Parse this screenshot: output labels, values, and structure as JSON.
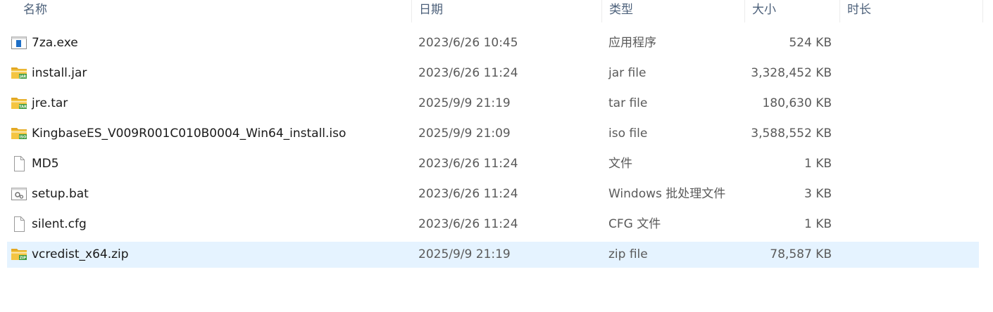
{
  "columns": {
    "name": "名称",
    "date": "日期",
    "type": "类型",
    "size": "大小",
    "duration": "时长"
  },
  "files": [
    {
      "name": "7za.exe",
      "date": "2023/6/26 10:45",
      "type": "应用程序",
      "size": "524 KB",
      "icon": "exe-app-icon"
    },
    {
      "name": "install.jar",
      "date": "2023/6/26 11:24",
      "type": "jar file",
      "size": "3,328,452 KB",
      "icon": "jar-archive-icon",
      "icon_tag": "JAR"
    },
    {
      "name": "jre.tar",
      "date": "2025/9/9 21:19",
      "type": "tar file",
      "size": "180,630 KB",
      "icon": "tar-archive-icon",
      "icon_tag": "TAR"
    },
    {
      "name": "KingbaseES_V009R001C010B0004_Win64_install.iso",
      "date": "2025/9/9 21:09",
      "type": "iso file",
      "size": "3,588,552 KB",
      "icon": "iso-archive-icon",
      "icon_tag": "ISO"
    },
    {
      "name": "MD5",
      "date": "2023/6/26 11:24",
      "type": "文件",
      "size": "1 KB",
      "icon": "blank-file-icon"
    },
    {
      "name": "setup.bat",
      "date": "2023/6/26 11:24",
      "type": "Windows 批处理文件",
      "size": "3 KB",
      "icon": "batch-file-icon"
    },
    {
      "name": "silent.cfg",
      "date": "2023/6/26 11:24",
      "type": "CFG 文件",
      "size": "1 KB",
      "icon": "blank-file-icon"
    },
    {
      "name": "vcredist_x64.zip",
      "date": "2025/9/9 21:19",
      "type": "zip file",
      "size": "78,587 KB",
      "icon": "zip-archive-icon",
      "icon_tag": "ZIP",
      "selected": true
    }
  ],
  "colors": {
    "selection": "#e5f3ff",
    "header_text": "#4c607a",
    "archive_folder": "#f4c542",
    "archive_tag": "#3c9a3c",
    "exe_blue": "#1e6fc7"
  }
}
